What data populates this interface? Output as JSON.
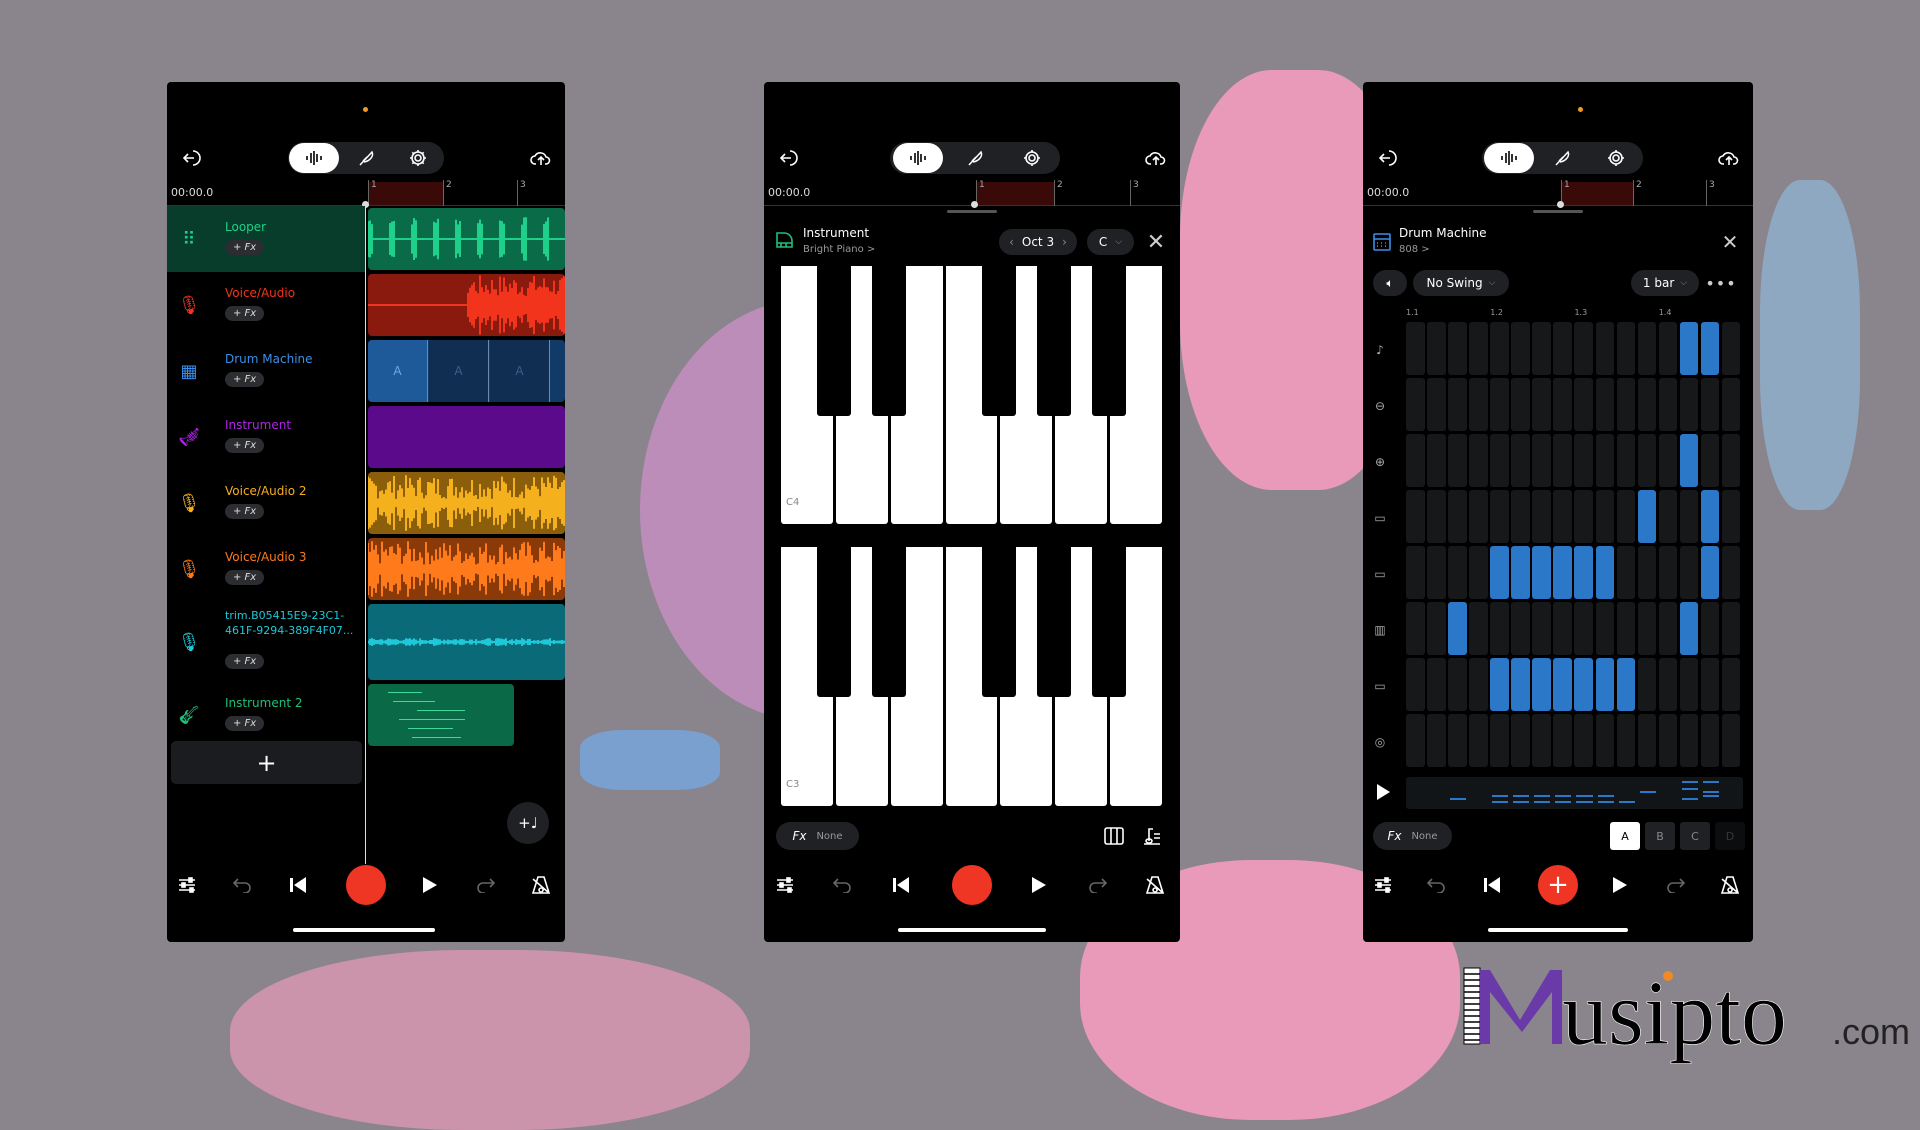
{
  "colors": {
    "background": "#8a858c",
    "accent_record": "#ef3524",
    "step_on": "#2b78c8",
    "pink": "#e89ab8"
  },
  "toolbar": {
    "icons": [
      "back-icon",
      "waveform-icon",
      "quill-icon",
      "gear-icon",
      "cloud-upload-icon"
    ]
  },
  "timeline": {
    "time": "00:00.0",
    "markers": [
      "1",
      "2",
      "3"
    ]
  },
  "tracks": [
    {
      "name": "Looper",
      "fx": "+ Fx",
      "icon": "looper-grid-icon",
      "color": "#1fd08a",
      "clip": "#0a6b48"
    },
    {
      "name": "Voice/Audio",
      "fx": "+ Fx",
      "icon": "microphone-icon",
      "color": "#f2341c",
      "clip": "#8a1a0e"
    },
    {
      "name": "Drum Machine",
      "fx": "+ Fx",
      "icon": "drum-machine-icon",
      "color": "#3b8fe8",
      "clip": "#123a66",
      "pattern": "A"
    },
    {
      "name": "Instrument",
      "fx": "+ Fx",
      "icon": "trumpet-icon",
      "color": "#b026e8",
      "clip": "#5a0a8a"
    },
    {
      "name": "Voice/Audio 2",
      "fx": "+ Fx",
      "icon": "microphone-icon",
      "color": "#f5b01e",
      "clip": "#8a5e0a"
    },
    {
      "name": "Voice/Audio 3",
      "fx": "+ Fx",
      "icon": "microphone-icon",
      "color": "#ff7a1a",
      "clip": "#8a3a08"
    },
    {
      "name": "trim.B05415E9-23C1-461F-9294-389F4F07...",
      "fx": "+ Fx",
      "icon": "microphone-icon",
      "color": "#1ec8d8",
      "clip": "#0a6a78"
    },
    {
      "name": "Instrument 2",
      "fx": "+ Fx",
      "icon": "guitar-icon",
      "color": "#1fc07a",
      "clip": "#0a6a48"
    }
  ],
  "add_track": "+",
  "instrument": {
    "title": "Instrument",
    "subtitle": "Bright Piano >",
    "octave": "Oct 3",
    "key": "C",
    "octave_labels": [
      "C4",
      "C3"
    ],
    "fx_label": "Fx",
    "fx_value": "None"
  },
  "drum": {
    "title": "Drum Machine",
    "subtitle": "808 >",
    "swing": "No Swing",
    "length": "1 bar",
    "beats": [
      "1.1",
      "1.2",
      "1.3",
      "1.4"
    ],
    "rows": [
      "crash",
      "ride",
      "hihat",
      "tom-high",
      "tom-mid",
      "snare",
      "tom-low",
      "kick"
    ],
    "steps": [
      [
        13,
        14
      ],
      [],
      [
        13
      ],
      [
        11,
        14
      ],
      [
        4,
        5,
        6,
        7,
        8,
        9,
        14
      ],
      [
        2,
        13
      ],
      [
        4,
        5,
        6,
        7,
        8,
        9,
        10
      ],
      []
    ],
    "fx_label": "Fx",
    "fx_value": "None",
    "patterns": [
      "A",
      "B",
      "C",
      "D"
    ],
    "active_pattern": "A"
  },
  "logo": {
    "text": "Musipto",
    "suffix": ".com"
  }
}
